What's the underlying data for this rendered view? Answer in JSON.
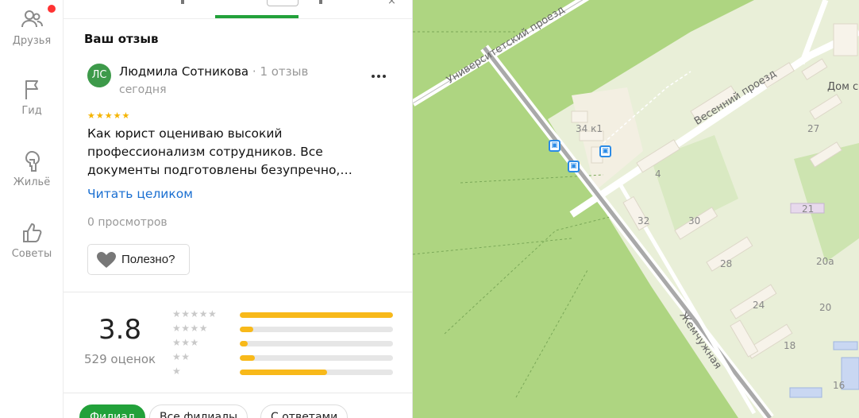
{
  "nav": {
    "items": [
      {
        "label": "Друзья",
        "icon": "friends-icon"
      },
      {
        "label": "Гид",
        "icon": "flag-icon"
      },
      {
        "label": "Жильё",
        "icon": "housing-icon"
      },
      {
        "label": "Советы",
        "icon": "thumbs-up-icon"
      }
    ]
  },
  "review": {
    "section_title": "Ваш отзыв",
    "avatar_initials": "ЛС",
    "author_name": "Людмила Сотникова",
    "author_reviews": "1 отзыв",
    "date": "сегодня",
    "stars": "★★★★★",
    "text": "Как юрист оцениваю высокий профессионализм сотрудников. Все документы подготовлены безупречно,…",
    "read_more": "Читать целиком",
    "views": "0 просмотров",
    "helpful_label": "Полезно?"
  },
  "rating": {
    "score": "3.8",
    "count": "529 оценок",
    "distribution": [
      {
        "stars": "★★★★★",
        "fraction": 1.0
      },
      {
        "stars": "★★★★",
        "fraction": 0.09
      },
      {
        "stars": "★★★",
        "fraction": 0.05
      },
      {
        "stars": "★★",
        "fraction": 0.1
      },
      {
        "stars": "★",
        "fraction": 0.57
      }
    ]
  },
  "filters": [
    {
      "label": "Филиал",
      "active": true
    },
    {
      "label": "Все филиалы",
      "active": false
    },
    {
      "label": "С ответами",
      "active": false
    }
  ],
  "map": {
    "streets": [
      "Университетский проезд",
      "Весенний проезд",
      "Жемчужная"
    ],
    "place": "Дом с",
    "houses": [
      "34 к1",
      "4",
      "32",
      "30",
      "27",
      "21",
      "28",
      "20а",
      "24",
      "20",
      "18",
      "16"
    ]
  },
  "colors": {
    "accent_green": "#22a13a",
    "star_yellow": "#f8b91a",
    "link_blue": "#1a6fd1",
    "map_green": "#aed581"
  }
}
